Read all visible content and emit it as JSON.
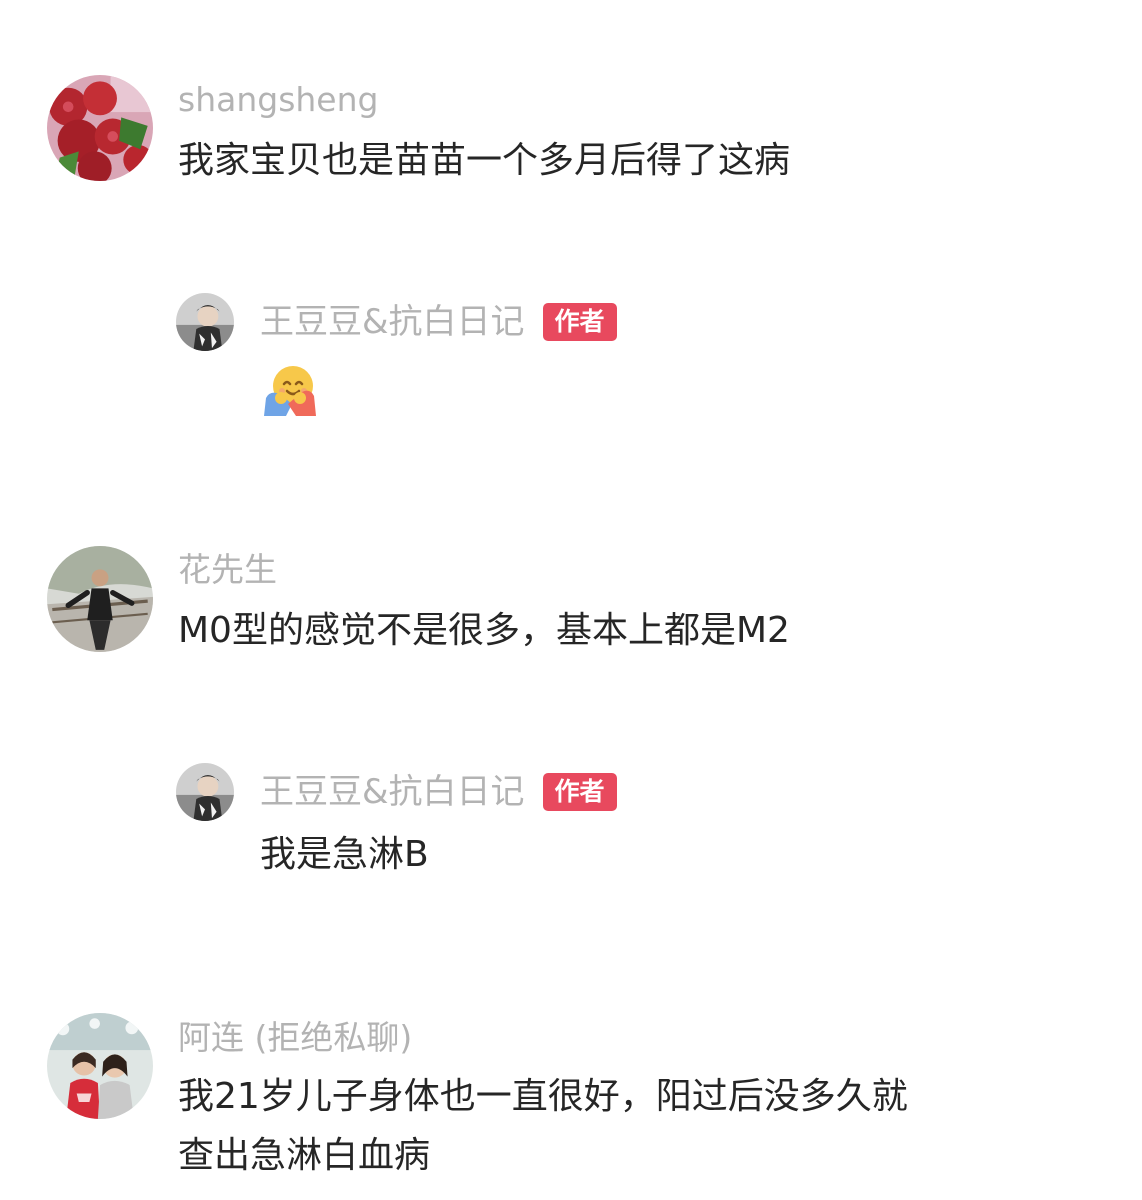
{
  "comments": [
    {
      "avatar_icon": "tomato-avatar-icon",
      "author": "shangsheng",
      "text": "我家宝贝也是苗苗一个多月后得了这病",
      "reply": {
        "avatar_icon": "author-avatar-icon",
        "author": "王豆豆&抗白日记",
        "badge": "作者",
        "emoji_icon": "hugging-face-emoji"
      }
    },
    {
      "avatar_icon": "man-photo-avatar-icon",
      "author": "花先生",
      "text": "M0型的感觉不是很多，基本上都是M2",
      "reply": {
        "avatar_icon": "author-avatar-icon",
        "author": "王豆豆&抗白日记",
        "badge": "作者",
        "text": "我是急淋B"
      }
    },
    {
      "avatar_icon": "women-photo-avatar-icon",
      "author": "阿连 (拒绝私聊)",
      "text_line1": "我21岁儿子身体也一直很好，阳过后没多久就",
      "text_line2": "查出急淋白血病"
    }
  ],
  "colors": {
    "author_name": "#b3b3b3",
    "comment_text": "#262626",
    "badge_bg": "#e8495e",
    "badge_text": "#ffffff"
  }
}
